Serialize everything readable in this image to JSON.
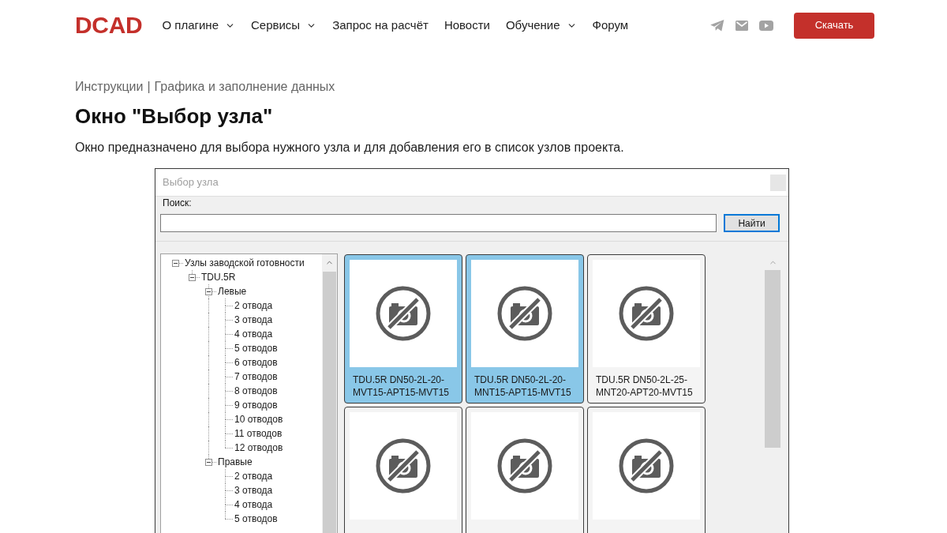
{
  "header": {
    "logo": "DCAD",
    "nav": [
      {
        "label": "О плагине",
        "dropdown": true
      },
      {
        "label": "Сервисы",
        "dropdown": true
      },
      {
        "label": "Запрос на расчёт",
        "dropdown": false
      },
      {
        "label": "Новости",
        "dropdown": false
      },
      {
        "label": "Обучение",
        "dropdown": true
      },
      {
        "label": "Форум",
        "dropdown": false
      }
    ],
    "download_button": "Скачать"
  },
  "breadcrumb": {
    "items": [
      "Инструкции",
      "Графика и заполнение данных"
    ],
    "separator": "|"
  },
  "title": "Окно \"Выбор узла\"",
  "intro": "Окно предназначено для выбора нужного узла и для добавления его в список узлов проекта.",
  "dialog": {
    "title": "Выбор узла",
    "search_label": "Поиск:",
    "find_button": "Найти",
    "tree": [
      {
        "label": "Узлы заводской готовности",
        "expanded": true,
        "children": [
          {
            "label": "TDU.5R",
            "expanded": true,
            "children": [
              {
                "label": "Левые",
                "expanded": true,
                "children": [
                  {
                    "label": "2 отвода"
                  },
                  {
                    "label": "3 отвода"
                  },
                  {
                    "label": "4 отвода"
                  },
                  {
                    "label": "5 отводов"
                  },
                  {
                    "label": "6 отводов"
                  },
                  {
                    "label": "7 отводов"
                  },
                  {
                    "label": "8 отводов"
                  },
                  {
                    "label": "9 отводов"
                  },
                  {
                    "label": "10 отводов"
                  },
                  {
                    "label": "11 отводов"
                  },
                  {
                    "label": "12 отводов"
                  }
                ]
              },
              {
                "label": "Правые",
                "expanded": true,
                "children": [
                  {
                    "label": "2 отвода"
                  },
                  {
                    "label": "3 отвода"
                  },
                  {
                    "label": "4 отвода"
                  },
                  {
                    "label": "5 отводов"
                  }
                ]
              }
            ]
          }
        ]
      }
    ],
    "cards": [
      {
        "label": "TDU.5R DN50-2L-20-MVT15-APT15-MVT15",
        "selected": true
      },
      {
        "label": "TDU.5R DN50-2L-20-MNT15-APT15-MVT15",
        "selected": true
      },
      {
        "label": "TDU.5R DN50-2L-25-MNT20-APT20-MVT15",
        "selected": false
      },
      {
        "selected": false
      },
      {
        "selected": false
      },
      {
        "selected": false
      }
    ]
  }
}
